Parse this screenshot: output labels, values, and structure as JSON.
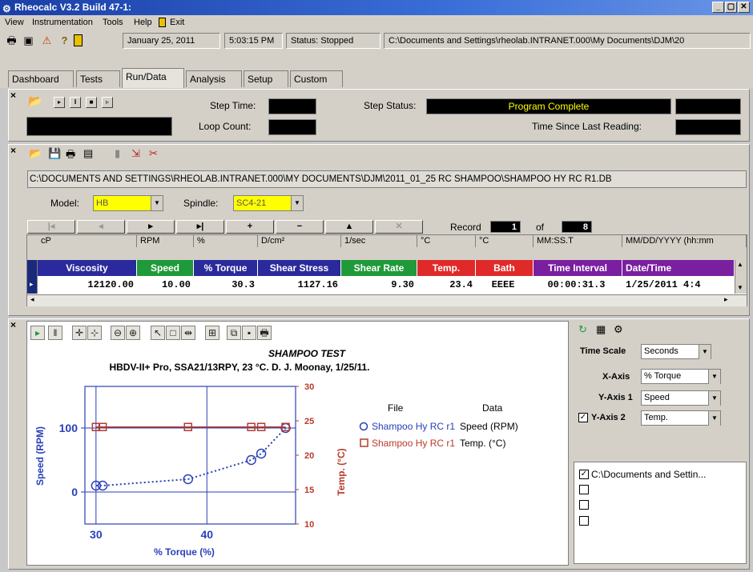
{
  "window": {
    "title": "Rheocalc V3.2 Build 47-1:",
    "controls": [
      "_",
      "▢",
      "✕"
    ]
  },
  "menu": [
    "View",
    "Instrumentation",
    "Tools",
    "Help",
    "Exit"
  ],
  "toolbar": {
    "date": "January 25, 2011",
    "time": "5:03:15 PM",
    "status": "Status: Stopped",
    "path": "C:\\Documents and Settings\\rheolab.INTRANET.000\\My Documents\\DJM\\20"
  },
  "tabs": [
    "Dashboard",
    "Tests",
    "Run/Data",
    "Analysis",
    "Setup",
    "Custom"
  ],
  "step": {
    "step_time_label": "Step Time:",
    "loop_count_label": "Loop Count:",
    "step_status_label": "Step Status:",
    "step_status_value": "Program Complete",
    "time_since_label": "Time Since Last Reading:"
  },
  "file": {
    "path": "C:\\DOCUMENTS AND SETTINGS\\RHEOLAB.INTRANET.000\\MY DOCUMENTS\\DJM\\2011_01_25 RC SHAMPOO\\SHAMPOO HY RC R1.DB",
    "model_label": "Model:",
    "model_value": "HB",
    "spindle_label": "Spindle:",
    "spindle_value": "SC4-21"
  },
  "nav": {
    "buttons": [
      "|◂",
      "◂",
      "▸",
      "▸|",
      "+",
      "−",
      "▲",
      "✕"
    ],
    "record_label": "Record",
    "record_value": "1",
    "of_label": "of",
    "total_value": "8"
  },
  "table": {
    "units": [
      "cP",
      "RPM",
      "%",
      "D/cm²",
      "1/sec",
      "°C",
      "°C",
      "MM:SS.T",
      "MM/DD/YYYY (hh:mm"
    ],
    "headers": [
      {
        "label": "Viscosity",
        "color": "#2a2a9c"
      },
      {
        "label": "Speed",
        "color": "#1f9a3a"
      },
      {
        "label": "% Torque",
        "color": "#2a2a9c"
      },
      {
        "label": "Shear Stress",
        "color": "#2a2a9c"
      },
      {
        "label": "Shear Rate",
        "color": "#1f9a3a"
      },
      {
        "label": "Temp.",
        "color": "#e02a2a"
      },
      {
        "label": "Bath",
        "color": "#e02a2a"
      },
      {
        "label": "Time Interval",
        "color": "#7a1fa0"
      },
      {
        "label": "Date/Time",
        "color": "#7a1fa0"
      }
    ],
    "row": [
      "12120.00",
      "10.00",
      "30.3",
      "1127.16",
      "9.30",
      "23.4",
      "EEEE",
      "00:00:31.3",
      "1/25/2011 4:4"
    ]
  },
  "plot": {
    "title": "SHAMPOO TEST",
    "subtitle": "HBDV-II+ Pro, SSA21/13RPY, 23 °C.  D. J. Moonay, 1/25/11.",
    "legend": {
      "file_header": "File",
      "data_header": "Data",
      "entries": [
        {
          "file": "Shampoo Hy RC r1",
          "data": "Speed (RPM)",
          "color": "#2a3fb8",
          "marker": "circle"
        },
        {
          "file": "Shampoo Hy RC r1",
          "data": "Temp. (°C)",
          "color": "#b83a2a",
          "marker": "square"
        }
      ]
    }
  },
  "chart_data": {
    "type": "scatter",
    "xlabel": "% Torque (%)",
    "ylabel": "Speed (RPM)",
    "y2label": "Temp. (°C)",
    "xticks": [
      "30",
      "40"
    ],
    "yticks": [
      "0",
      "100"
    ],
    "y2ticks": [
      "10",
      "15",
      "20",
      "25",
      "30"
    ],
    "xlim": [
      29,
      48
    ],
    "ylim": [
      -50,
      165
    ],
    "y2lim": [
      10,
      30
    ],
    "series": [
      {
        "name": "Speed (RPM)",
        "axis": "y",
        "style": "dotted",
        "color": "#2a3fb8",
        "x": [
          30.0,
          30.6,
          38.3,
          44.0,
          44.9,
          47.1
        ],
        "y": [
          10,
          10,
          20,
          50,
          60,
          100
        ]
      },
      {
        "name": "Temp. (°C)",
        "axis": "y2",
        "style": "solid",
        "color": "#b83a2a",
        "x": [
          30.0,
          30.6,
          38.3,
          44.0,
          44.9,
          47.1
        ],
        "y": [
          24.1,
          24.1,
          24.1,
          24.1,
          24.1,
          24.1
        ]
      }
    ]
  },
  "side": {
    "time_scale_label": "Time Scale",
    "time_scale_value": "Seconds",
    "xaxis_label": "X-Axis",
    "xaxis_value": "% Torque",
    "y1_label": "Y-Axis 1",
    "y1_value": "Speed",
    "y2_label": "Y-Axis 2",
    "y2_value": "Temp.",
    "files": [
      "C:\\Documents and Settin...",
      "",
      "",
      ""
    ]
  }
}
